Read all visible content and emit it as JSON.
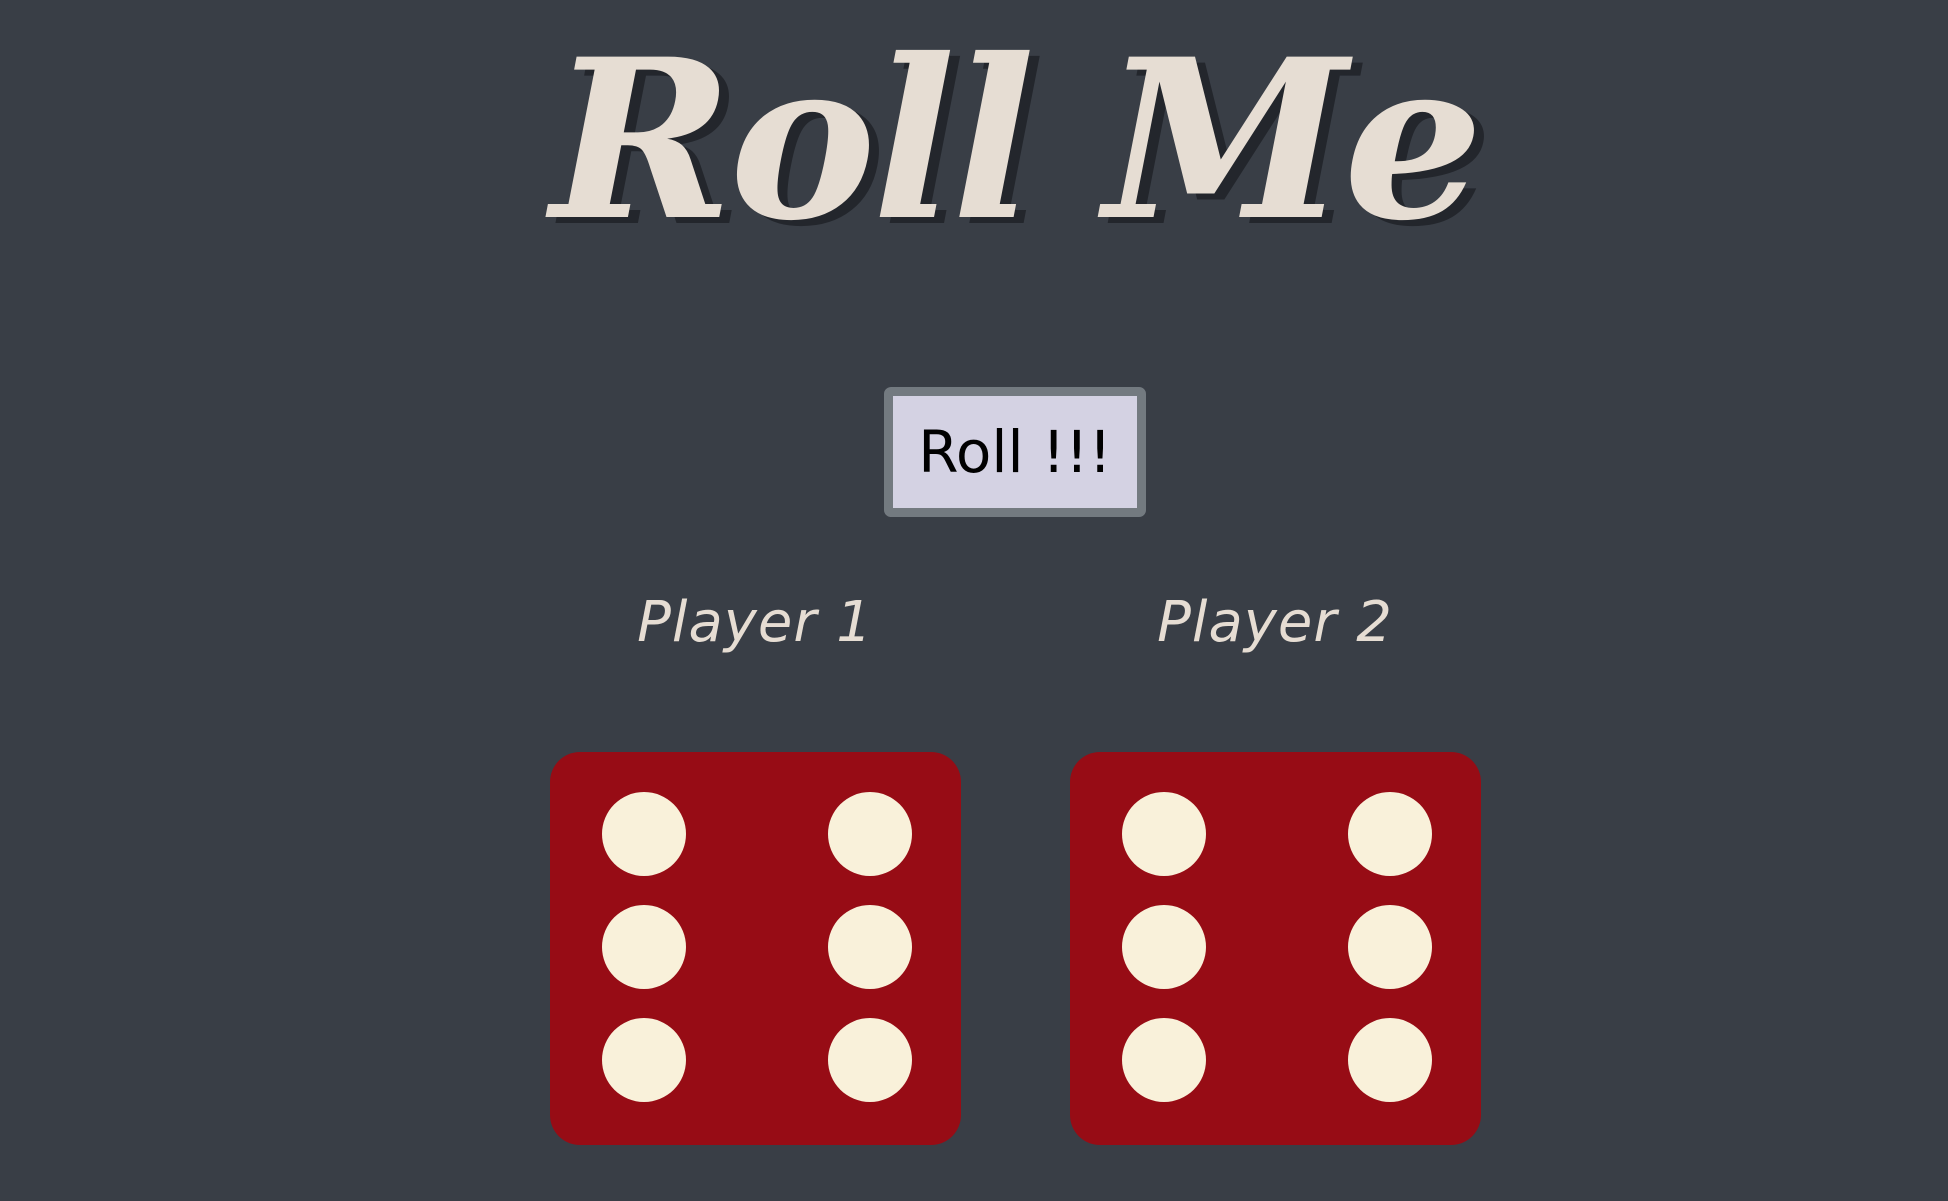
{
  "title": "Roll Me",
  "roll_button": {
    "label": "Roll !!!"
  },
  "players": [
    {
      "label": "Player 1",
      "die_value": 6
    },
    {
      "label": "Player 2",
      "die_value": 6
    }
  ],
  "colors": {
    "background": "#393e46",
    "title_text": "#e6ddd3",
    "die_face": "#970c15",
    "pip": "#f9f1da",
    "button_fill": "#d4d2e3",
    "button_border": "#737a80"
  }
}
